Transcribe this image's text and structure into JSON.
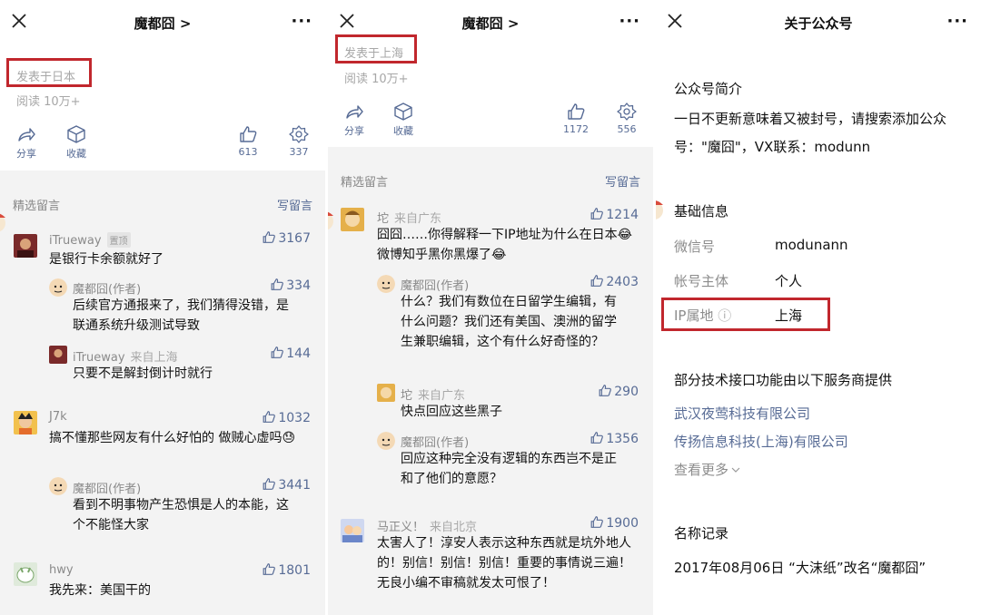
{
  "panel1": {
    "title": "魔都囧 >",
    "more": "···",
    "location": "发表于日本",
    "reads": "阅读 10万+",
    "share": "分享",
    "collect": "收藏",
    "likes": "613",
    "wows": "337",
    "section_title": "精选留言",
    "write": "写留言",
    "comments": [
      {
        "name": "iTrueway",
        "badge": "置顶",
        "likes": "3167",
        "text": "是银行卡余额就好了"
      },
      {
        "name": "魔都囧(作者)",
        "likes": "334",
        "text": "后续官方通报来了，我们猜得没错，是联通系统升级测试导致"
      },
      {
        "name": "iTrueway",
        "loc": "来自上海",
        "likes": "144",
        "text": "只要不是解封倒计时就行"
      },
      {
        "name": "J7k",
        "likes": "1032",
        "text": "搞不懂那些网友有什么好怕的 做贼心虚吗😓"
      },
      {
        "name": "魔都囧(作者)",
        "likes": "3441",
        "text": "看到不明事物产生恐惧是人的本能，这个不能怪大家"
      },
      {
        "name": "hwy",
        "likes": "1801",
        "text": "我先来：美国干的"
      }
    ]
  },
  "panel2": {
    "title": "魔都囧 >",
    "more": "···",
    "location": "发表于上海",
    "reads": "阅读 10万+",
    "share": "分享",
    "collect": "收藏",
    "likes": "1172",
    "wows": "556",
    "section_title": "精选留言",
    "write": "写留言",
    "comments": [
      {
        "name": "坨",
        "loc": "来自广东",
        "likes": "1214",
        "text": "囧囧……你得解释一下IP地址为什么在日本😂微博知乎黑你黑爆了😂"
      },
      {
        "name": "魔都囧(作者)",
        "likes": "2403",
        "text": "什么？我们有数位在日留学生编辑，有什么问题？我们还有美国、澳洲的留学生兼职编辑，这个有什么好奇怪的？"
      },
      {
        "name": "坨",
        "loc": "来自广东",
        "likes": "290",
        "text": "快点回应这些黑子"
      },
      {
        "name": "魔都囧(作者)",
        "likes": "1356",
        "text": "回应这种完全没有逻辑的东西岂不是正和了他们的意愿？"
      },
      {
        "name": "马正义！",
        "loc": "来自北京",
        "likes": "1900",
        "text": "太害人了！淳安人表示这种东西就是坑外地人的！别信！别信！别信！重要的事情说三遍！无良小编不审稿就发太可恨了！"
      }
    ]
  },
  "panel3": {
    "title": "关于公众号",
    "more": "···",
    "intro_heading": "公众号简介",
    "intro_text": "一日不更新意味着又被封号，请搜索添加公众号：\"魔囧\"，VX联系：modunn",
    "basic_heading": "基础信息",
    "wechat_id_label": "微信号",
    "wechat_id_value": "modunann",
    "owner_label": "帐号主体",
    "owner_value": "个人",
    "ip_label": "IP属地",
    "ip_info_icon": "ⓘ",
    "ip_value": "上海",
    "providers_heading": "部分技术接口功能由以下服务商提供",
    "provider_1": "武汉夜莺科技有限公司",
    "provider_2": "传扬信息科技(上海)有限公司",
    "see_more": "查看更多",
    "name_history_heading": "名称记录",
    "name_history_text": "2017年08月06日 “大沫纸”改名“魔都囧”"
  },
  "colors": {
    "highlight_box": "#c1272d",
    "link": "#576b95",
    "muted": "#a7a7a7",
    "gray_bg": "#f3f3f3"
  },
  "icons": [
    "close-icon",
    "share-icon",
    "collect-icon",
    "thumbs-up-icon",
    "wow-icon",
    "info-icon",
    "chevron-down-icon"
  ]
}
